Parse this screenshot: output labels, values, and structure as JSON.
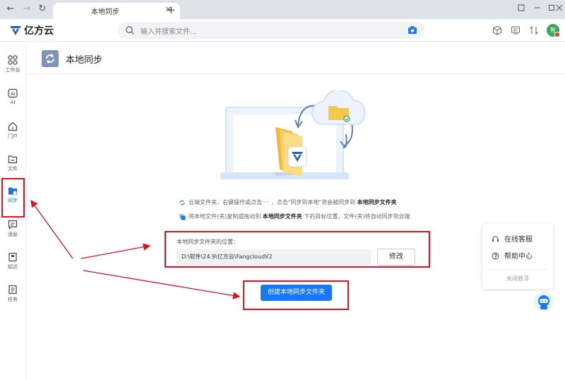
{
  "browser": {
    "tab_title": "本地同步",
    "close_label": "✕",
    "newtab_label": "+",
    "back_label": "←",
    "forward_label": "→",
    "reload_label": "↻"
  },
  "app": {
    "logo_text": "亿方云",
    "search_placeholder": "输入并搜索文件...",
    "avatar_text": "智"
  },
  "sidebar": {
    "items": [
      {
        "label": "工作台",
        "icon": "grid-icon"
      },
      {
        "label": "AI",
        "icon": "ai-icon"
      },
      {
        "label": "门户",
        "icon": "home-icon"
      },
      {
        "label": "文件",
        "icon": "file-icon"
      },
      {
        "label": "同步",
        "icon": "sync-folder-icon"
      },
      {
        "label": "消息",
        "icon": "message-icon"
      },
      {
        "label": "知识",
        "icon": "book-icon"
      },
      {
        "label": "任务",
        "icon": "task-icon"
      }
    ]
  },
  "page": {
    "title": "本地同步",
    "tip1_pre": "云端文件夹，右键操作或点击 ··· ，点击\"同步到本地\"将会被同步到",
    "tip1_bold": "本地同步文件夹",
    "tip2_pre": "将本地文件(夹)复制或拖动到",
    "tip2_bold": "本地同步文件夹",
    "tip2_post": "下的目标位置，文件(夹)将自动同步到云端",
    "path_label": "本地同步文件夹的位置：",
    "path_value": "D:\\软件\\24.9\\亿方云\\FangcloudV2",
    "modify_label": "修改",
    "create_label": "创建本地同步文件夹"
  },
  "help": {
    "online_service": "在线客服",
    "help_center": "帮助中心",
    "close_float": "关闭悬浮"
  },
  "colors": {
    "accent": "#1677ff",
    "annotation": "#e0101e"
  }
}
